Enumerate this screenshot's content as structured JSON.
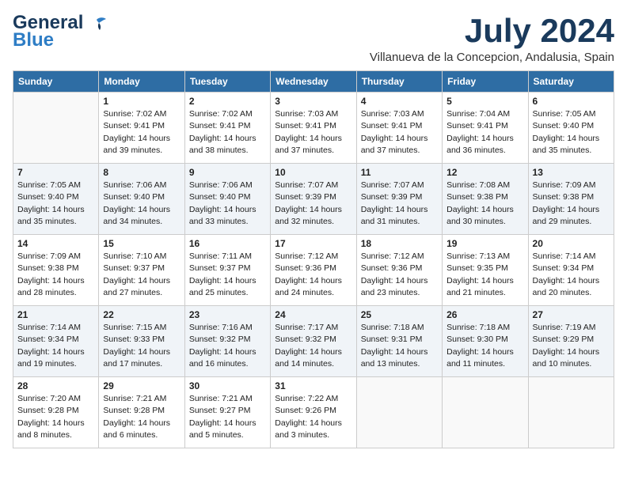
{
  "header": {
    "logo_line1": "General",
    "logo_line2": "Blue",
    "month_title": "July 2024",
    "subtitle": "Villanueva de la Concepcion, Andalusia, Spain"
  },
  "days_of_week": [
    "Sunday",
    "Monday",
    "Tuesday",
    "Wednesday",
    "Thursday",
    "Friday",
    "Saturday"
  ],
  "weeks": [
    [
      {
        "date": "",
        "info": ""
      },
      {
        "date": "1",
        "info": "Sunrise: 7:02 AM\nSunset: 9:41 PM\nDaylight: 14 hours\nand 39 minutes."
      },
      {
        "date": "2",
        "info": "Sunrise: 7:02 AM\nSunset: 9:41 PM\nDaylight: 14 hours\nand 38 minutes."
      },
      {
        "date": "3",
        "info": "Sunrise: 7:03 AM\nSunset: 9:41 PM\nDaylight: 14 hours\nand 37 minutes."
      },
      {
        "date": "4",
        "info": "Sunrise: 7:03 AM\nSunset: 9:41 PM\nDaylight: 14 hours\nand 37 minutes."
      },
      {
        "date": "5",
        "info": "Sunrise: 7:04 AM\nSunset: 9:41 PM\nDaylight: 14 hours\nand 36 minutes."
      },
      {
        "date": "6",
        "info": "Sunrise: 7:05 AM\nSunset: 9:40 PM\nDaylight: 14 hours\nand 35 minutes."
      }
    ],
    [
      {
        "date": "7",
        "info": "Sunrise: 7:05 AM\nSunset: 9:40 PM\nDaylight: 14 hours\nand 35 minutes."
      },
      {
        "date": "8",
        "info": "Sunrise: 7:06 AM\nSunset: 9:40 PM\nDaylight: 14 hours\nand 34 minutes."
      },
      {
        "date": "9",
        "info": "Sunrise: 7:06 AM\nSunset: 9:40 PM\nDaylight: 14 hours\nand 33 minutes."
      },
      {
        "date": "10",
        "info": "Sunrise: 7:07 AM\nSunset: 9:39 PM\nDaylight: 14 hours\nand 32 minutes."
      },
      {
        "date": "11",
        "info": "Sunrise: 7:07 AM\nSunset: 9:39 PM\nDaylight: 14 hours\nand 31 minutes."
      },
      {
        "date": "12",
        "info": "Sunrise: 7:08 AM\nSunset: 9:38 PM\nDaylight: 14 hours\nand 30 minutes."
      },
      {
        "date": "13",
        "info": "Sunrise: 7:09 AM\nSunset: 9:38 PM\nDaylight: 14 hours\nand 29 minutes."
      }
    ],
    [
      {
        "date": "14",
        "info": "Sunrise: 7:09 AM\nSunset: 9:38 PM\nDaylight: 14 hours\nand 28 minutes."
      },
      {
        "date": "15",
        "info": "Sunrise: 7:10 AM\nSunset: 9:37 PM\nDaylight: 14 hours\nand 27 minutes."
      },
      {
        "date": "16",
        "info": "Sunrise: 7:11 AM\nSunset: 9:37 PM\nDaylight: 14 hours\nand 25 minutes."
      },
      {
        "date": "17",
        "info": "Sunrise: 7:12 AM\nSunset: 9:36 PM\nDaylight: 14 hours\nand 24 minutes."
      },
      {
        "date": "18",
        "info": "Sunrise: 7:12 AM\nSunset: 9:36 PM\nDaylight: 14 hours\nand 23 minutes."
      },
      {
        "date": "19",
        "info": "Sunrise: 7:13 AM\nSunset: 9:35 PM\nDaylight: 14 hours\nand 21 minutes."
      },
      {
        "date": "20",
        "info": "Sunrise: 7:14 AM\nSunset: 9:34 PM\nDaylight: 14 hours\nand 20 minutes."
      }
    ],
    [
      {
        "date": "21",
        "info": "Sunrise: 7:14 AM\nSunset: 9:34 PM\nDaylight: 14 hours\nand 19 minutes."
      },
      {
        "date": "22",
        "info": "Sunrise: 7:15 AM\nSunset: 9:33 PM\nDaylight: 14 hours\nand 17 minutes."
      },
      {
        "date": "23",
        "info": "Sunrise: 7:16 AM\nSunset: 9:32 PM\nDaylight: 14 hours\nand 16 minutes."
      },
      {
        "date": "24",
        "info": "Sunrise: 7:17 AM\nSunset: 9:32 PM\nDaylight: 14 hours\nand 14 minutes."
      },
      {
        "date": "25",
        "info": "Sunrise: 7:18 AM\nSunset: 9:31 PM\nDaylight: 14 hours\nand 13 minutes."
      },
      {
        "date": "26",
        "info": "Sunrise: 7:18 AM\nSunset: 9:30 PM\nDaylight: 14 hours\nand 11 minutes."
      },
      {
        "date": "27",
        "info": "Sunrise: 7:19 AM\nSunset: 9:29 PM\nDaylight: 14 hours\nand 10 minutes."
      }
    ],
    [
      {
        "date": "28",
        "info": "Sunrise: 7:20 AM\nSunset: 9:28 PM\nDaylight: 14 hours\nand 8 minutes."
      },
      {
        "date": "29",
        "info": "Sunrise: 7:21 AM\nSunset: 9:28 PM\nDaylight: 14 hours\nand 6 minutes."
      },
      {
        "date": "30",
        "info": "Sunrise: 7:21 AM\nSunset: 9:27 PM\nDaylight: 14 hours\nand 5 minutes."
      },
      {
        "date": "31",
        "info": "Sunrise: 7:22 AM\nSunset: 9:26 PM\nDaylight: 14 hours\nand 3 minutes."
      },
      {
        "date": "",
        "info": ""
      },
      {
        "date": "",
        "info": ""
      },
      {
        "date": "",
        "info": ""
      }
    ]
  ]
}
